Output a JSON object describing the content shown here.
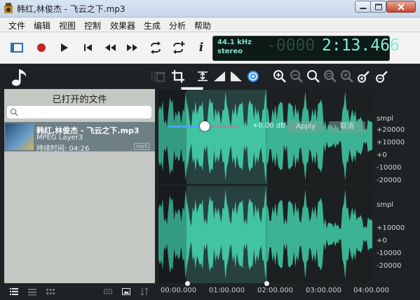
{
  "window": {
    "title": "韩红,林俊杰 - 飞云之下.mp3"
  },
  "menu": {
    "items": [
      "文件",
      "编辑",
      "视图",
      "控制",
      "效果器",
      "生成",
      "分析",
      "帮助"
    ]
  },
  "toolbar": {
    "icons": [
      "view-toggle-icon",
      "record-icon",
      "play-icon",
      "skip-start-icon",
      "rewind-icon",
      "fast-forward-icon",
      "loop-icon",
      "loop-add-icon",
      "info-icon"
    ],
    "info_label": "i"
  },
  "display": {
    "sample_rate": "44.1 kHz",
    "channels": "stereo",
    "ghost_digits": "-0000",
    "time": "2:13.466"
  },
  "sidebar": {
    "title": "已打开的文件",
    "search_placeholder": "",
    "files": [
      {
        "name": "韩红,林俊杰 - 飞云之下.mp3",
        "format": "MPEG Layer3",
        "duration": "持续时间: 04:26",
        "tag": "mp3"
      }
    ]
  },
  "tools": {
    "tooltip": "裁剪"
  },
  "effect_overlay": {
    "gain_label": "+0.00 dB",
    "apply_label": "Apply",
    "cancel_label": "取消",
    "gain_slider_fraction": 0.52
  },
  "ruler": {
    "ticks": [
      "00:00.000",
      "01:00.000",
      "02:00.000",
      "03:00.000",
      "04:00.000"
    ]
  },
  "scale": {
    "unit": "smpl",
    "labels": [
      "smpl",
      "+20000",
      "+10000",
      "+0",
      "-10000",
      "-20000",
      "smpl",
      "+10000",
      "+0",
      "-10000",
      "-20000"
    ]
  },
  "colors": {
    "waveform": "#3fbf9e",
    "waveform_selected": "#40c9a8",
    "background": "#1e2224",
    "accent": "#4ea3ff",
    "lcd_text": "#7ff0d2"
  }
}
